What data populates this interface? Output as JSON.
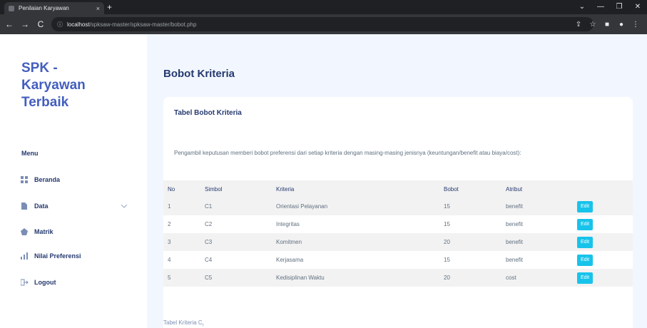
{
  "browser": {
    "tab_title": "Penilaian Karyawan",
    "tab_close": "×",
    "new_tab": "+",
    "url_host": "localhost",
    "url_path": "/spksaw-master/spksaw-master/bobot.php",
    "back": "←",
    "forward": "→",
    "reload": "C",
    "info": "ⓘ",
    "win_min": "—",
    "win_max": "❐",
    "win_close": "✕",
    "win_chev": "⌄",
    "share": "⇪",
    "star": "☆",
    "ext": "■",
    "profile": "●",
    "more": "⋮"
  },
  "sidebar": {
    "brand_line1": "SPK -",
    "brand_line2": "Karyawan",
    "brand_line3": "Terbaik",
    "menu_title": "Menu",
    "items": [
      {
        "label": "Beranda",
        "icon": "grid-icon"
      },
      {
        "label": "Data",
        "icon": "file-icon"
      },
      {
        "label": "Matrik",
        "icon": "pentagon-icon"
      },
      {
        "label": "Nilai Preferensi",
        "icon": "bar-chart-icon"
      },
      {
        "label": "Logout",
        "icon": "logout-icon"
      }
    ]
  },
  "main": {
    "page_title": "Bobot Kriteria",
    "card_title": "Tabel Bobot Kriteria",
    "description": "Pengambil keputusan memberi bobot preferensi dari setiap kriteria dengan masing-masing jenisnya (keuntungan/benefit atau biaya/cost):",
    "headers": [
      "No",
      "Simbol",
      "Kriteria",
      "Bobot",
      "Atribut"
    ],
    "rows": [
      {
        "no": "1",
        "simbol": "C1",
        "kriteria": "Orientasi Pelayanan",
        "bobot": "15",
        "atribut": "benefit",
        "action": "Edit"
      },
      {
        "no": "2",
        "simbol": "C2",
        "kriteria": "Integritas",
        "bobot": "15",
        "atribut": "benefit",
        "action": "Edit"
      },
      {
        "no": "3",
        "simbol": "C3",
        "kriteria": "Komitmen",
        "bobot": "20",
        "atribut": "benefit",
        "action": "Edit"
      },
      {
        "no": "4",
        "simbol": "C4",
        "kriteria": "Kerjasama",
        "bobot": "15",
        "atribut": "benefit",
        "action": "Edit"
      },
      {
        "no": "5",
        "simbol": "C5",
        "kriteria": "Kedisiplinan Waktu",
        "bobot": "20",
        "atribut": "cost",
        "action": "Edit"
      }
    ],
    "caption": "Tabel Kriteria C",
    "caption_sub": "i"
  }
}
